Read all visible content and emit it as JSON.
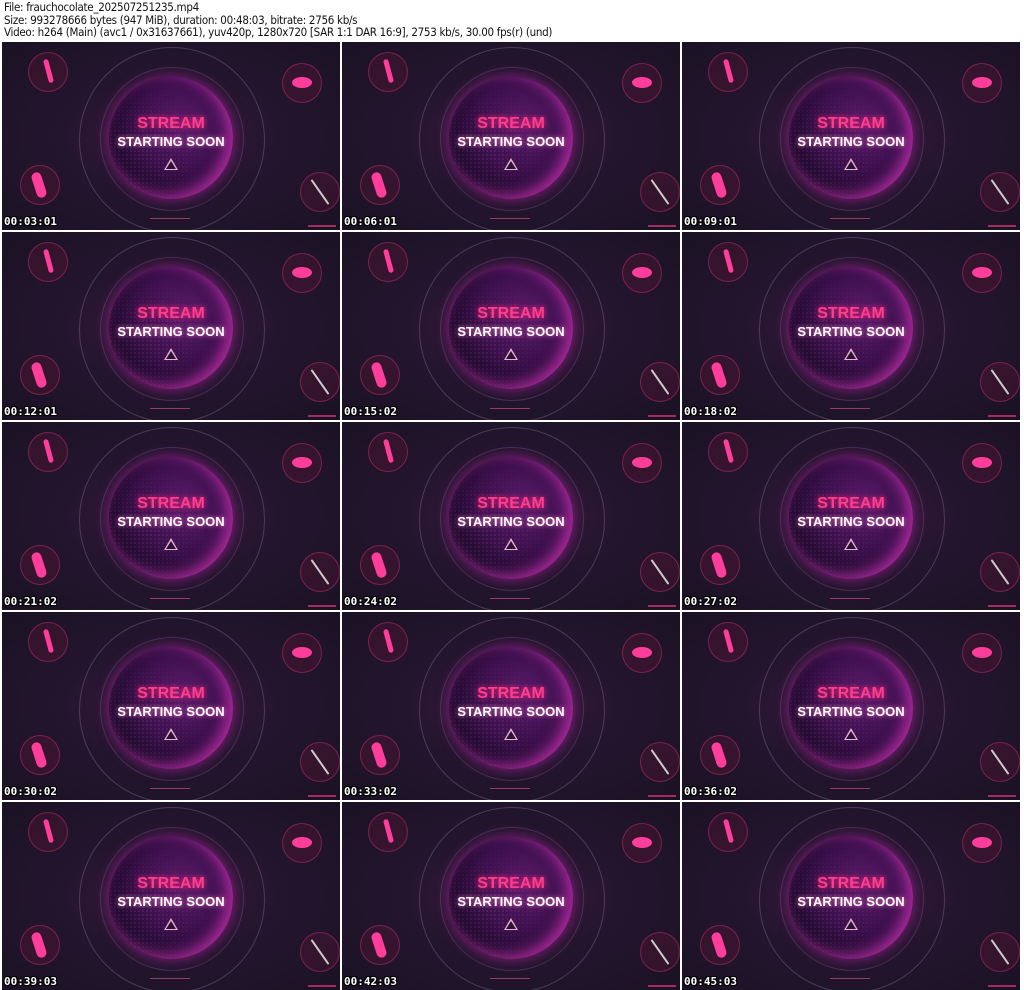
{
  "header": {
    "file_line": "File: frauchocolate_202507251235.mp4",
    "size_line": "Size: 993278666 bytes (947 MiB), duration: 00:48:03, bitrate: 2756 kb/s",
    "video_line": "Video: h264 (Main) (avc1 / 0x31637661), yuv420p, 1280x720 [SAR 1:1 DAR 16:9], 2753 kb/s, 30.00 fps(r) (und)"
  },
  "frame_text": {
    "title": "STREAM",
    "subtitle": "STARTING SOON"
  },
  "colors": {
    "accent": "#ff3d8e",
    "background": "#1e1228"
  },
  "thumbnails": [
    {
      "timestamp": "00:03:01"
    },
    {
      "timestamp": "00:06:01"
    },
    {
      "timestamp": "00:09:01"
    },
    {
      "timestamp": "00:12:01"
    },
    {
      "timestamp": "00:15:02"
    },
    {
      "timestamp": "00:18:02"
    },
    {
      "timestamp": "00:21:02"
    },
    {
      "timestamp": "00:24:02"
    },
    {
      "timestamp": "00:27:02"
    },
    {
      "timestamp": "00:30:02"
    },
    {
      "timestamp": "00:33:02"
    },
    {
      "timestamp": "00:36:02"
    },
    {
      "timestamp": "00:39:03"
    },
    {
      "timestamp": "00:42:03"
    },
    {
      "timestamp": "00:45:03"
    }
  ]
}
